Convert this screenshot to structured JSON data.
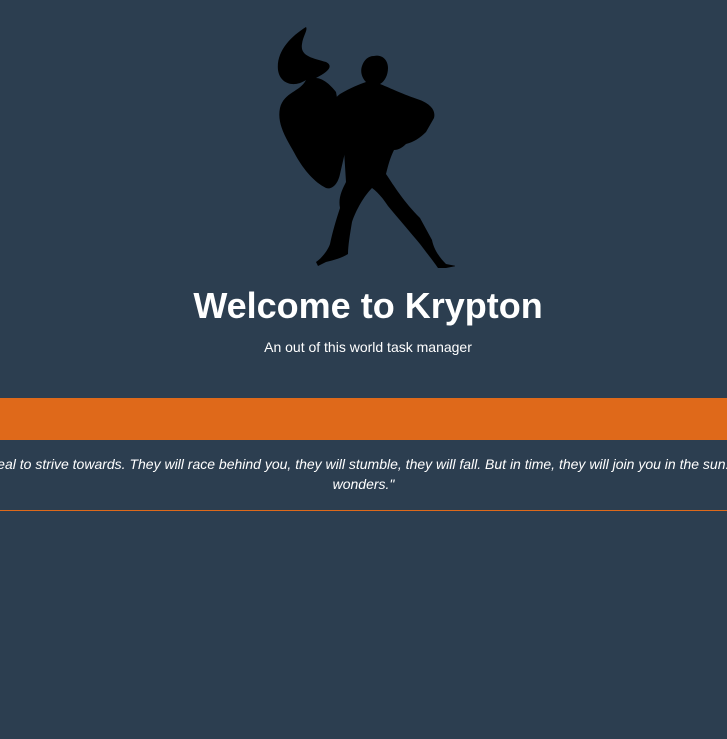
{
  "hero": {
    "logo_icon": "superhero-silhouette-icon",
    "title": "Welcome to Krypton",
    "subtitle": "An out of this world task manager"
  },
  "quote": {
    "text": "\"You will give the people of Earth an ideal to strive towards. They will race behind you, they will stumble, they will fall. But in time, they will join you in the sun. In time, you will help them accomplish wonders.\""
  },
  "colors": {
    "background": "#2c3e50",
    "accent": "#df691a",
    "text": "#ffffff"
  }
}
